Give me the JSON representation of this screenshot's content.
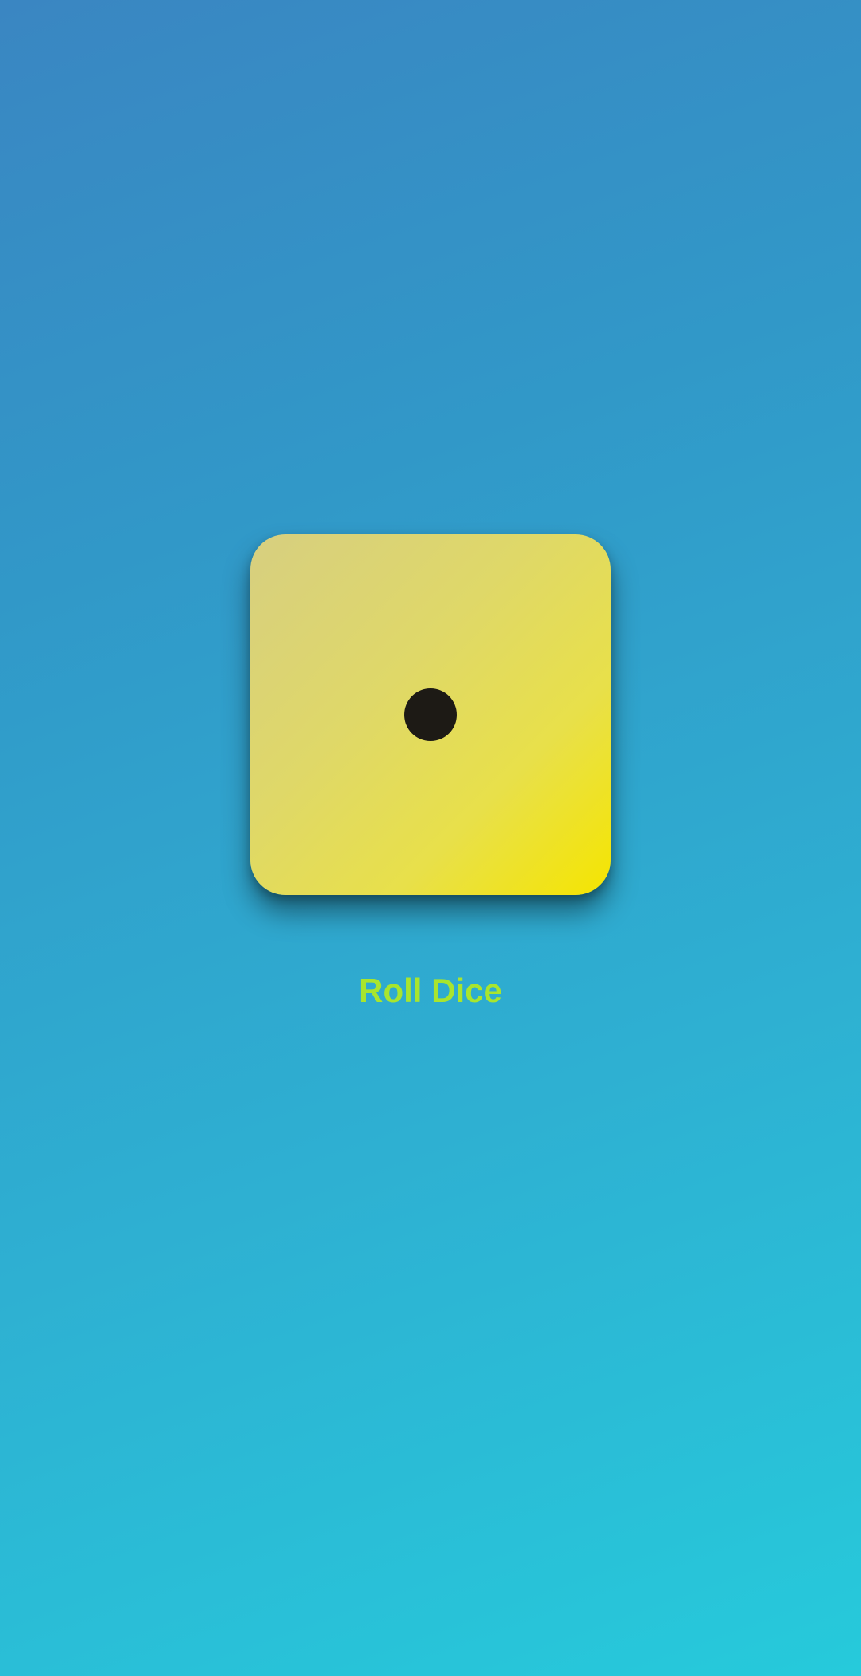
{
  "dice": {
    "face_value": 1,
    "face_color": "#e8e04a",
    "pip_color": "#1d1a15"
  },
  "actions": {
    "roll_label": "Roll Dice",
    "roll_color": "#a8e52e"
  },
  "theme": {
    "background_top": "#3a86c2",
    "background_bottom": "#26cadb"
  }
}
